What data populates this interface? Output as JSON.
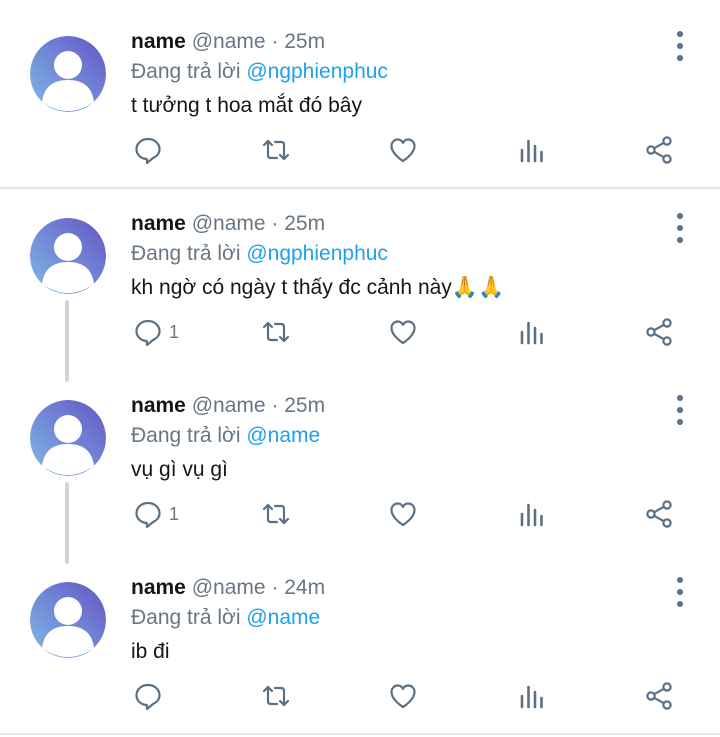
{
  "tweets": [
    {
      "name": "name",
      "meta": "@name · 25m",
      "reply_prefix": "Đang trả lời",
      "reply_handle": "@ngphienphuc",
      "text": "t tưởng t hoa mắt đó bây",
      "reply_count": ""
    },
    {
      "name": "name",
      "meta": "@name · 25m",
      "reply_prefix": "Đang trả lời",
      "reply_handle": "@ngphienphuc",
      "text": "kh ngờ có ngày t thấy đc cảnh này🙏🙏",
      "reply_count": "1"
    },
    {
      "name": "name",
      "meta": "@name · 25m",
      "reply_prefix": "Đang trả lời",
      "reply_handle": "@name",
      "text": "vụ gì vụ gì",
      "reply_count": "1"
    },
    {
      "name": "name",
      "meta": "@name · 24m",
      "reply_prefix": "Đang trả lời",
      "reply_handle": "@name",
      "text": "ib đi",
      "reply_count": ""
    }
  ],
  "icons": {
    "reply": "reply-icon",
    "retweet": "retweet-icon",
    "like": "heart-icon",
    "stats": "stats-icon",
    "share": "share-icon",
    "more": "more-vertical-icon",
    "avatar": "default-avatar-icon"
  },
  "colors": {
    "link": "#1da1f2",
    "muted": "#687684",
    "icon": "#5b7083",
    "avatar_light": "#7fb3e6",
    "avatar_dark": "#6a5fc7"
  }
}
